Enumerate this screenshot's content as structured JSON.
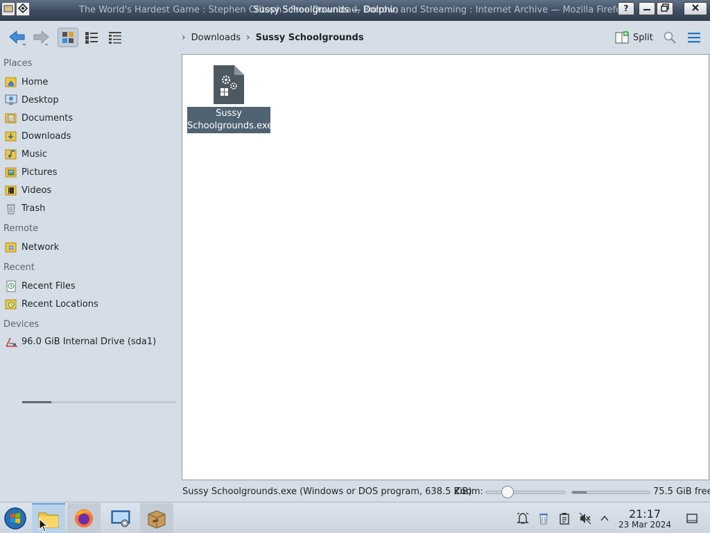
{
  "window": {
    "background_title": "The World's Hardest Game : Stephen Critoph : Free Download, Borrow, and Streaming : Internet Archive — Mozilla Firefox",
    "title": "Sussy Schoolgrounds — Dolphin",
    "help_label": "?"
  },
  "toolbar": {
    "breadcrumb": [
      "Downloads",
      "Sussy Schoolgrounds"
    ],
    "split_label": "Split"
  },
  "sidebar": {
    "sections": {
      "places": "Places",
      "remote": "Remote",
      "recent": "Recent",
      "devices": "Devices"
    },
    "places": [
      "Home",
      "Desktop",
      "Documents",
      "Downloads",
      "Music",
      "Pictures",
      "Videos",
      "Trash"
    ],
    "remote": [
      "Network"
    ],
    "recent": [
      "Recent Files",
      "Recent Locations"
    ],
    "devices": [
      {
        "label": "96.0 GiB Internal Drive (sda1)",
        "used_fraction": 0.19
      }
    ]
  },
  "main": {
    "files": [
      {
        "name_line1": "Sussy",
        "name_line2": "Schoolgrounds.exe",
        "selected": true,
        "icon": "executable-icon"
      }
    ]
  },
  "status": {
    "file_info": "Sussy Schoolgrounds.exe (Windows or DOS program, 638.5 KiB)",
    "zoom_label": "Zoom:",
    "zoom_level_fraction": 0.28,
    "free_label": "75.5 GiB free",
    "used_fraction": 0.19
  },
  "taskbar": {
    "time": "21:17",
    "date": "23 Mar 2024"
  },
  "colors": {
    "selection": "#506373",
    "accent": "#3daee9",
    "folder": "#f0c73e"
  }
}
